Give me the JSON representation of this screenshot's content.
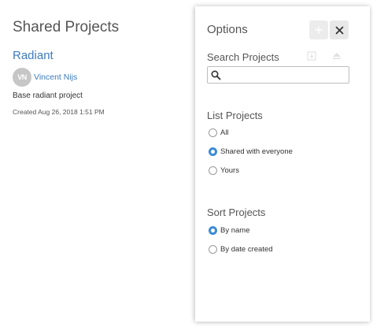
{
  "main": {
    "title": "Shared Projects",
    "project": {
      "title": "Radiant",
      "owner_initials": "VN",
      "owner_name": "Vincent Nijs",
      "description": "Base radiant project",
      "created": "Created Aug 26, 2018 1:51 PM"
    }
  },
  "options": {
    "title": "Options",
    "add_symbol": "+",
    "search": {
      "label": "Search Projects",
      "value": "",
      "placeholder": ""
    },
    "list": {
      "label": "List Projects",
      "options": [
        {
          "label": "All",
          "checked": false
        },
        {
          "label": "Shared with everyone",
          "checked": true
        },
        {
          "label": "Yours",
          "checked": false
        }
      ]
    },
    "sort": {
      "label": "Sort Projects",
      "options": [
        {
          "label": "By name",
          "checked": true
        },
        {
          "label": "By date created",
          "checked": false
        }
      ]
    }
  },
  "colors": {
    "link": "#3d7bbf",
    "radio_checked": "#3d8bd8"
  },
  "icons": [
    "plus-icon",
    "close-icon",
    "search-icon",
    "import-icon",
    "eject-icon"
  ]
}
